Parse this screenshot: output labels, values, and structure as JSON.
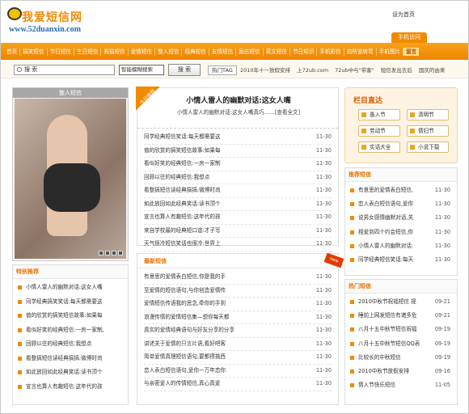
{
  "header": {
    "logo_title": "我爱短信网",
    "logo_url": "www.52duanxin.com",
    "homepage_link": "设为首页",
    "mobile_tab": "手机访问"
  },
  "nav": [
    "首页",
    "搞笑短信",
    "节日短信",
    "生日短信",
    "祝福短信",
    "爱情短信",
    "整人短信",
    "经典短信",
    "友情短信",
    "励志短信",
    "英文短信",
    "节日知识",
    "手机彩信",
    "前所逆转弯",
    "手机图片",
    "留言"
  ],
  "search": {
    "input_value": "搜 索",
    "select_value": "智能模糊搜索",
    "button_label": "搜 索",
    "hot_label": "热门TAG",
    "hot_tags": [
      "2010年十一放假安排",
      "上72ub.com",
      "72ub中与\"带客\"",
      "短信发出去后",
      "国庆的由来"
    ]
  },
  "left": {
    "image_caption": "整人短信",
    "special_title": "特别推荐",
    "special_items": [
      "小情人雷人的幽默对话:这女人嘴",
      "同学经典搞笑笑话:每天都需要这",
      "值的欣赏的搞笑短信故事:如果每",
      "看似好笑的经典短信:一房一家制,",
      "回顾以往的经典短信:我想点",
      "看整搞短信读经典搞搞:微博时尚",
      "如此放回如此经典笑话:读书顶个",
      "宣言也算人有趣短信:这年代的孩"
    ]
  },
  "middle": {
    "ribbon": "今日推荐",
    "headline": "小情人雷人的幽默对话:这女人嘴",
    "summary": "小情人雷人的幽默对话:这女人嘴真巧……[查看全文]",
    "items": [
      {
        "text": "同学经典短信笑话:每天都需要这",
        "date": "11-30"
      },
      {
        "text": "值的欣赏的搞笑短信故事:如果每",
        "date": "11-30"
      },
      {
        "text": "看似好笑的经典短信:一房一家制",
        "date": "11-30"
      },
      {
        "text": "回顾以往的经典短信:我想点",
        "date": "11-30"
      },
      {
        "text": "看整搞短信读经典搞搞:微博时尚",
        "date": "11-30"
      },
      {
        "text": "如此放回如此经典笑话:读书顶个",
        "date": "11-30"
      },
      {
        "text": "宣言也算人有趣短信:这年代的孩",
        "date": "11-30"
      },
      {
        "text": "来自学校最的经典短口谊:才子写",
        "date": "11-30"
      },
      {
        "text": "天气很冷短信笑话也很冷:世界上",
        "date": "11-30"
      }
    ],
    "second_title": "最新短信",
    "second_flag": "new",
    "second_items": [
      {
        "text": "有意思的爱情表白短信,你是我的手",
        "date": "11-30"
      },
      {
        "text": "至爱情的短信语句,与你创造爱情传",
        "date": "11-30"
      },
      {
        "text": "爱情短信传语我的思念,牵你的手到",
        "date": "11-30"
      },
      {
        "text": "浪漫传情的爱情短信集—想你每天都",
        "date": "11-30"
      },
      {
        "text": "真实的爱情经典语句与好友分享的分享",
        "date": "11-30"
      },
      {
        "text": "讲述关于爱情的只言片语,看好吧客",
        "date": "11-30"
      },
      {
        "text": "简单爱情真理短信语句,要都得挑西",
        "date": "11-30"
      },
      {
        "text": "恋人表白短信语句,爱你一万年恋你",
        "date": "11-30"
      },
      {
        "text": "与亲密爱人的传情短信,真心真爱",
        "date": "11-30"
      }
    ]
  },
  "right": {
    "direct_title": "栏目直达",
    "direct_items": [
      "愚人节",
      "清明节",
      "劳动节",
      "情妇节",
      "实话大全",
      "小说下载"
    ],
    "rec_title": "推荐短信",
    "rec_items": [
      {
        "text": "有意思的爱情表白短信,",
        "date": "11-30"
      },
      {
        "text": "恋人表白短信语句,爱你",
        "date": "11-30"
      },
      {
        "text": "说男女感情幽默对话,关",
        "date": "11-30"
      },
      {
        "text": "相爱到四个约会短信,你",
        "date": "11-30"
      },
      {
        "text": "小情人雷人的幽默对话:",
        "date": "11-30"
      },
      {
        "text": "同学经典短信笑话:每天",
        "date": "11-30"
      }
    ],
    "hot_title": "热门短信",
    "hot_items": [
      {
        "text": "2010中秋节祝福短信 视",
        "date": "09-21"
      },
      {
        "text": "睡前上网发短信有诸多危",
        "date": "09-21"
      },
      {
        "text": "八月十五中秋节短信祝福",
        "date": "09-19"
      },
      {
        "text": "八月十五中秋节短信QQ表",
        "date": "09-19"
      },
      {
        "text": "比较长的中秋短信",
        "date": "09-19"
      },
      {
        "text": "2010中秋节放假安排",
        "date": "09-16"
      },
      {
        "text": "情人节快乐短信",
        "date": "11-05"
      }
    ]
  }
}
